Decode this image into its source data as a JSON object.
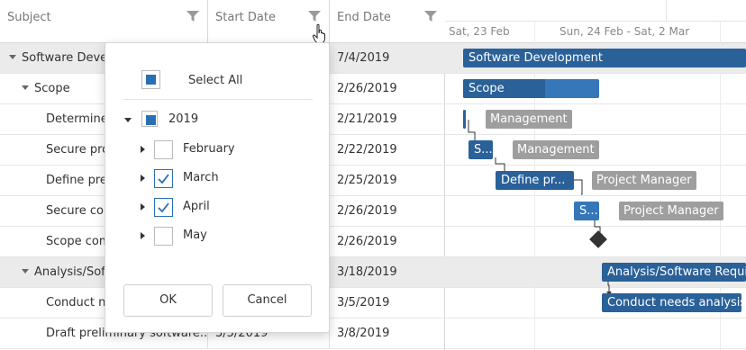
{
  "columns": {
    "subject": "Subject",
    "start_date": "Start Date",
    "end_date": "End Date"
  },
  "rows": [
    {
      "subject": "Software Devel",
      "start": "",
      "end": "7/4/2019",
      "level": 0,
      "group": true
    },
    {
      "subject": "Scope",
      "start": "",
      "end": "2/26/2019",
      "level": 1,
      "group": true
    },
    {
      "subject": "Determine",
      "start": "",
      "end": "2/21/2019",
      "level": 2,
      "group": false
    },
    {
      "subject": "Secure pro",
      "start": "",
      "end": "2/22/2019",
      "level": 2,
      "group": false
    },
    {
      "subject": "Define pre",
      "start": "",
      "end": "2/25/2019",
      "level": 2,
      "group": false
    },
    {
      "subject": "Secure cor",
      "start": "",
      "end": "2/26/2019",
      "level": 2,
      "group": false
    },
    {
      "subject": "Scope com",
      "start": "",
      "end": "2/26/2019",
      "level": 2,
      "group": false
    },
    {
      "subject": "Analysis/Soft",
      "start": "",
      "end": "3/18/2019",
      "level": 1,
      "group": true
    },
    {
      "subject": "Conduct n",
      "start": "",
      "end": "3/5/2019",
      "level": 2,
      "group": false
    },
    {
      "subject": "Draft preliminary software...",
      "start": "3/5/2019",
      "end": "3/8/2019",
      "level": 2,
      "group": false
    }
  ],
  "timeline": {
    "date1": "Sat, 23 Feb",
    "date2": "Sun, 24 Feb - Sat, 2 Mar"
  },
  "tasks": {
    "software_development": "Software Development",
    "scope": "Scope",
    "secure": "S...",
    "define": "Define pr...",
    "secure2": "S...",
    "analysis": "Analysis/Software Requir",
    "conduct": "Conduct needs analysis"
  },
  "resources": {
    "r1": "Management",
    "r2": "Management",
    "r3": "Project Manager",
    "r4": "Project Manager"
  },
  "filter_popup": {
    "select_all": "Select All",
    "year": "2019",
    "months": [
      "February",
      "March",
      "April",
      "May"
    ],
    "ok": "OK",
    "cancel": "Cancel"
  },
  "colors": {
    "accent": "#2a6fb5",
    "bar_dark": "#2a6199",
    "bar_light": "#3577b9",
    "resource": "#9e9e9e"
  }
}
